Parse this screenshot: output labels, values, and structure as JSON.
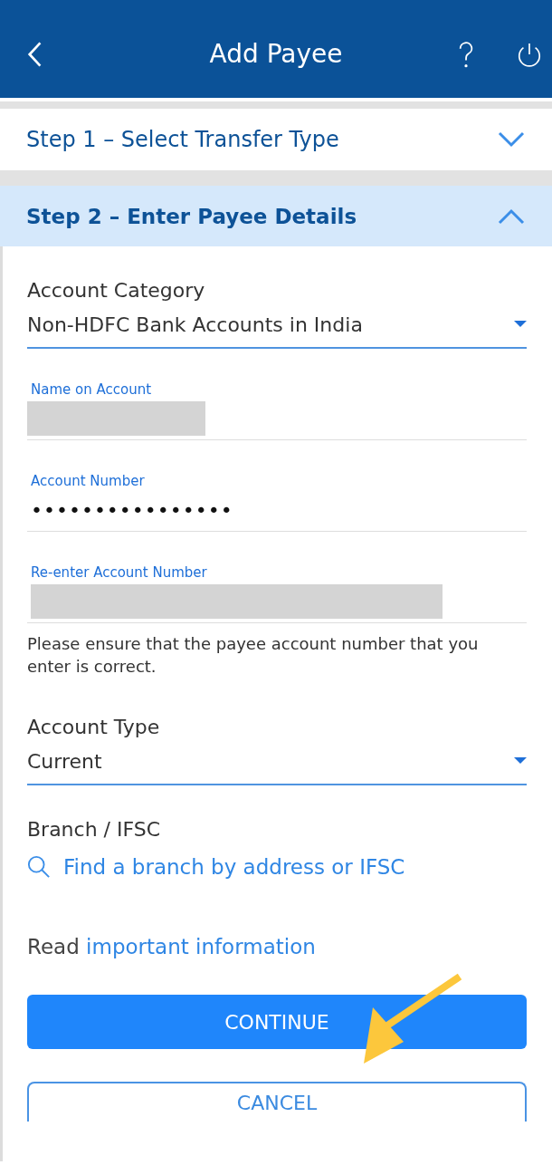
{
  "header": {
    "title": "Add Payee"
  },
  "steps": [
    {
      "label": "Step 1 – Select Transfer Type",
      "expanded": false
    },
    {
      "label": "Step 2 – Enter Payee Details",
      "expanded": true
    }
  ],
  "account_category": {
    "label": "Account Category",
    "value": "Non-HDFC Bank Accounts in India"
  },
  "fields": [
    {
      "label": "Name on Account",
      "redacted": true
    },
    {
      "label": "Account Number",
      "value": "••••••••••••••••",
      "redacted": false
    },
    {
      "label": "Re-enter Account Number",
      "redacted": true
    }
  ],
  "note": "Please ensure that the payee account number that you enter is correct.",
  "account_type": {
    "label": "Account Type",
    "value": "Current"
  },
  "branch": {
    "label": "Branch / IFSC",
    "link": "Find a branch by address or IFSC"
  },
  "info": {
    "prefix": "Read",
    "link": "important information"
  },
  "buttons": [
    {
      "label": "CONTINUE",
      "kind": "primary"
    },
    {
      "label": "CANCEL",
      "kind": "secondary"
    }
  ]
}
